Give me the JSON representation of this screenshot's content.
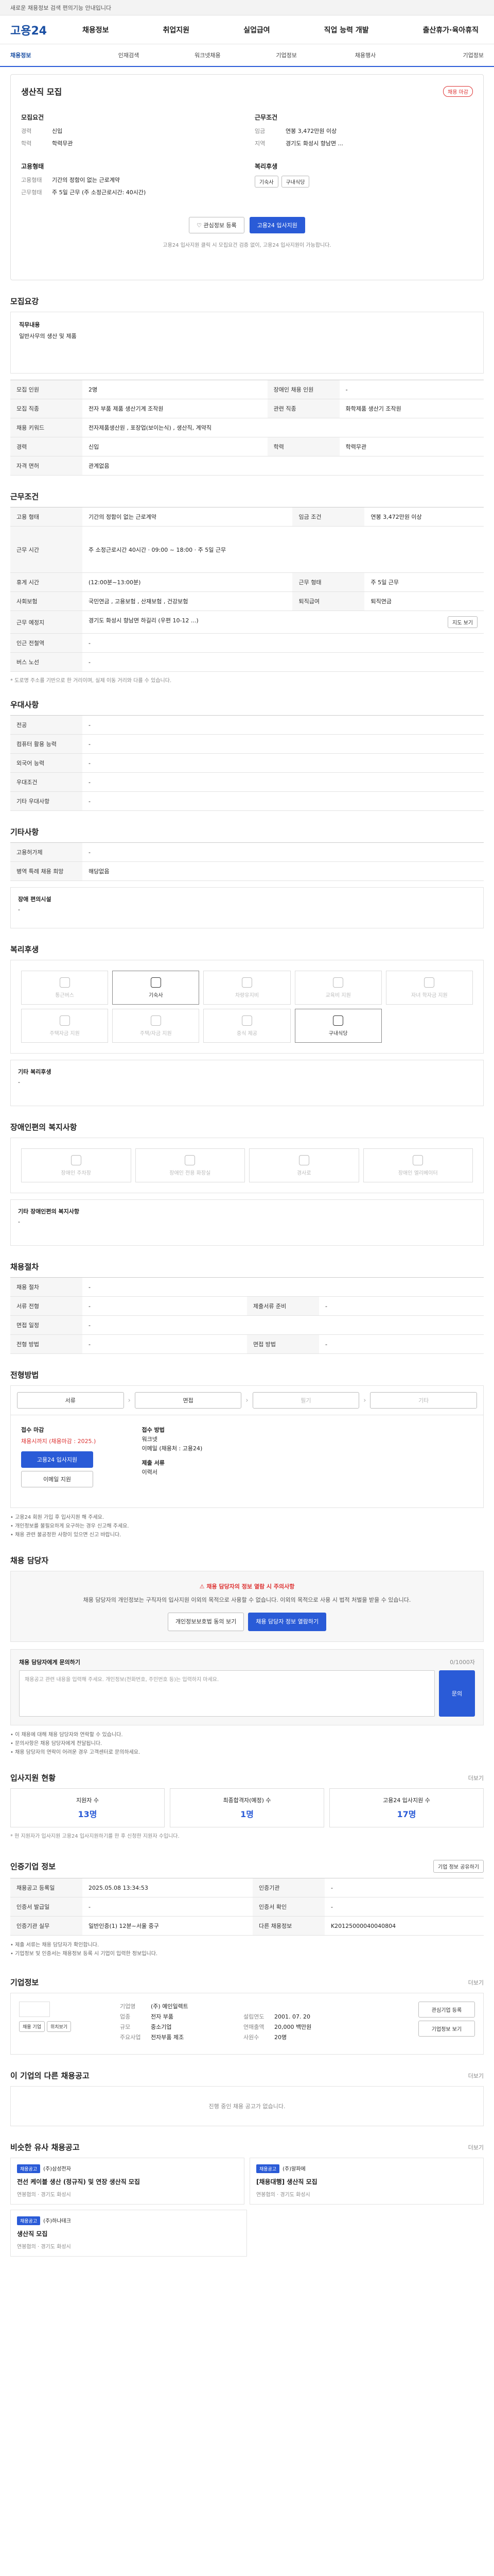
{
  "topbar": {
    "text": "새로운 채용정보 검색 편의기능 안내입니다"
  },
  "header": {
    "logo": "고용24",
    "gnb": [
      "채용정보",
      "취업지원",
      "실업급여",
      "직업 능력 개발",
      "출산휴가·육아휴직"
    ]
  },
  "subnav": [
    "채용정보",
    "인재검색",
    "워크넷채용",
    "기업정보",
    "채용행사",
    "기업정보"
  ],
  "job": {
    "badge": "채용 마감",
    "title": "생산직 모집",
    "left_title": "모집요건",
    "left_rows": [
      {
        "k": "경력",
        "v": "신입"
      },
      {
        "k": "학력",
        "v": "학력무관"
      }
    ],
    "left_title2": "고용형태",
    "left_rows2": [
      {
        "k": "고용형태",
        "v": "기간의 정함이 없는 근로계약"
      },
      {
        "k": "근무형태",
        "v": "주 5일 근무 (주 소정근로시간: 40시간)"
      }
    ],
    "right_title": "근무조건",
    "right_rows": [
      {
        "k": "임금",
        "v": "연봉 3,472만원 이상"
      },
      {
        "k": "지역",
        "v": "경기도 화성시 향남면 ..."
      }
    ],
    "right_title2": "복리후생",
    "right_tags": [
      "기숙사",
      "구내식당"
    ],
    "btn_interest": "관심정보 등록",
    "btn_apply": "고용24 입사지원",
    "apply_note": "고용24 입사지원 클릭 시 모집요건 검증 없이, 고용24 입사지원이 가능합니다."
  },
  "sec_recruit": {
    "title": "모집요강",
    "jobbox_title": "직무내용",
    "jobbox_desc": "일반사무의 생산 및 제품",
    "rows": [
      {
        "k": "모집 인원",
        "v": "2명",
        "k2": "장애인 채용 인원",
        "v2": "-"
      },
      {
        "k": "모집 직종",
        "v": "전자 부품 제품 생산기계 조작원",
        "k2": "관련 직종",
        "v2": "화학제품 생산기 조작원"
      },
      {
        "k": "채용 키워드",
        "v": "전자제품생산원 , 포장업(보이는식) , 생산직, 계약직",
        "k2": "",
        "v2": ""
      },
      {
        "k": "경력",
        "v": "신입",
        "k2": "학력",
        "v2": "학력무관"
      },
      {
        "k": "자격 면허",
        "v": "관계없음",
        "k2": "",
        "v2": ""
      }
    ]
  },
  "sec_cond": {
    "title": "근무조건",
    "rows": [
      {
        "k": "고용 형태",
        "v": "기간의 정함이 없는 근로계약",
        "k2": "임금 조건",
        "v2": "연봉 3,472만원 이상"
      },
      {
        "k": "근무 시간",
        "v": "주 소정근로시간 40시간 · 09:00 ~ 18:00 · 주 5일 근무",
        "k2": "",
        "v2": ""
      },
      {
        "k": "휴게 시간",
        "v": "(12:00분~13:00분)",
        "k2": "근무 형태",
        "v2": "주 5일 근무"
      },
      {
        "k": "사회보험",
        "v": "국민연금 , 고용보험 , 산재보험 , 건강보험",
        "k2": "퇴직급여",
        "v2": "퇴직연금"
      },
      {
        "k": "근무 예정지",
        "v": "경기도 화성시 향남면 하길리 (우편 10-12 ...)",
        "k2": "",
        "v2": ""
      },
      {
        "k": "인근 전철역",
        "v": "-",
        "k2": "",
        "v2": ""
      },
      {
        "k": "버스 노선",
        "v": "-",
        "k2": "",
        "v2": ""
      }
    ],
    "map_btn": "지도 보기",
    "note": "* 도로명 주소를 기반으로 한 거리이며, 실제 이동 거리와 다를 수 있습니다."
  },
  "sec_pref": {
    "title": "우대사항",
    "rows": [
      {
        "k": "전공",
        "v": "-"
      },
      {
        "k": "컴퓨터 활용 능력",
        "v": "-"
      },
      {
        "k": "외국어 능력",
        "v": "-"
      },
      {
        "k": "우대조건",
        "v": "-"
      },
      {
        "k": "기타 우대사항",
        "v": "-"
      }
    ]
  },
  "sec_other": {
    "title": "기타사항",
    "rows": [
      {
        "k": "고용허가제",
        "v": "-"
      },
      {
        "k": "병역 특례 채용 희망",
        "v": "해당없음"
      }
    ],
    "accessible_title": "장애 편의시설",
    "accessible_value": "-"
  },
  "sec_welfare": {
    "title": "복리후생",
    "items": [
      {
        "label": "통근버스",
        "on": false
      },
      {
        "label": "기숙사",
        "on": true
      },
      {
        "label": "차량유지비",
        "on": false
      },
      {
        "label": "교육비 지원",
        "on": false
      },
      {
        "label": "자녀 학자금 지원",
        "on": false
      },
      {
        "label": "주택자금 지원",
        "on": false
      },
      {
        "label": "주택/자금 지원",
        "on": false
      },
      {
        "label": "중식 제공",
        "on": false
      },
      {
        "label": "구내식당",
        "on": true
      }
    ],
    "other_title": "기타 복리후생",
    "other_value": "-"
  },
  "sec_disabled": {
    "title": "장애인편의 복지사항",
    "items": [
      "장애인 주차장",
      "장애인 전용 화장실",
      "경사로",
      "장애인 엘리베이터"
    ],
    "other_title": "기타 장애인편의 복지사항",
    "other_value": "-"
  },
  "sec_procedure": {
    "title": "채용절차",
    "rows": [
      {
        "k": "채용 절차",
        "v": "-"
      },
      {
        "k": "서류 전형",
        "v": "-",
        "k2": "제출서류 준비",
        "v2": "-"
      },
      {
        "k": "면접 일정",
        "v": "-",
        "k2": "",
        "v2": ""
      },
      {
        "k": "전형 방법",
        "v": "-",
        "k2": "면접 방법",
        "v2": "-"
      }
    ]
  },
  "sec_method": {
    "title": "전형방법",
    "steps": [
      "서류",
      "면접",
      "필기",
      "기타"
    ],
    "apply_title": "접수 마감",
    "apply_date": "채용시까지 (채용마감 : 2025.)",
    "apply_btn": "고용24 입사지원",
    "apply_btn2": "이메일 지원",
    "method_title": "접수 방법",
    "method_value": "워크넷",
    "method_value2": "이메일 (채용처 : 고용24)",
    "doc_title": "제출 서류",
    "doc_value": "이력서",
    "notes": [
      "고용24 회원 가입 후 입사지원 해 주세요.",
      "개인정보를 불필요하게 요구하는 경우 신고해 주세요.",
      "채용 관련 불공정한 사항이 있으면 신고 바랍니다."
    ]
  },
  "sec_contact": {
    "title": "채용 담당자",
    "notice_head": "채용 담당자의 정보 열람 시 주의사항",
    "notice_body": "채용 담당자의 개인정보는 구직자의 입사지원 이외의 목적으로 사용할 수 없습니다. 이외의 목적으로 사용 시 법적 처벌을 받을 수 있습니다.",
    "btn_agree": "개인정보보호법 동의 보기",
    "btn_view": "채용 담당자 정보 열람하기",
    "question_title": "채용 담당자에게 문의하기",
    "question_note": "0/1000자 ",
    "question_placeholder": "채용공고 관련 내용을 입력해 주세요. 개인정보(전화번호, 주민번호 등)는 입력하지 마세요.",
    "question_btn": "문의",
    "notes": [
      "이 채용에 대해 채용 담당자와 연락할 수 있습니다.",
      "문의사항은 채용 담당자에게 전달됩니다.",
      "채용 담당자의 연락이 어려운 경우 고객센터로 문의하세요."
    ]
  },
  "sec_stats": {
    "title": "입사지원 현황",
    "more": "더보기",
    "items": [
      {
        "label": "지원자 수",
        "value": "13명"
      },
      {
        "label": "최종합격자(예정) 수",
        "value": "1명"
      },
      {
        "label": "고용24 입사지원 수",
        "value": "17명"
      }
    ],
    "note": "* 현 지원자가 입사지원 고용24 입사지원하기를 한 후 신청한 지원자 수입니다."
  },
  "sec_company": {
    "title": "인증기업 정보",
    "btn": "기업 정보 공유하기",
    "rows": [
      {
        "k": "채용공고 등록일",
        "v": "2025.05.08 13:34:53",
        "k2": "인증기관",
        "v2": "-"
      },
      {
        "k": "인증서 발급일",
        "v": "-",
        "k2": "인증서 확인",
        "v2": "-"
      },
      {
        "k": "인증기관 실무",
        "v": "일반인증(1) 12분~서울 중구",
        "k2": "다른 채용정보",
        "v2": "K20125000040040804"
      }
    ],
    "notes": [
      "제출 서류는 채용 담당자가 확인합니다.",
      "기업정보 및 인증서는 채용정보 등록 시 기업이 입력한 정보입니다."
    ]
  },
  "sec_corp": {
    "title": "기업정보",
    "more": "더보기",
    "name_label": "기업명",
    "name": "(주) 예인일렉트",
    "btn_list": "채용 기업",
    "btn_map": "위치보기",
    "rows": [
      {
        "k": "업종",
        "v": "전자 부품",
        "k2": "설립연도",
        "v2": "2001. 07. 20"
      },
      {
        "k": "규모",
        "v": "중소기업",
        "k2": "연매출액",
        "v2": "20,000 백만원"
      },
      {
        "k": "주요사업",
        "v": "전자부품 제조",
        "k2": "사원수",
        "v2": "20명"
      }
    ],
    "side_btn1": "관심기업 등록",
    "side_btn2": "기업정보 보기"
  },
  "sec_same_corp": {
    "title": "이 기업의 다른 채용공고",
    "more": "더보기",
    "empty": "진행 중인 채용 공고가 없습니다."
  },
  "sec_similar": {
    "title": "비슷한 유사 채용공고",
    "more": "더보기",
    "cards": [
      {
        "chip": "채용공고",
        "org": "(주)삼성전자",
        "title": "전선 케이블 생산 (정규직) 및 연장 생산직 모집",
        "pay": "연봉협의",
        "region": "경기도 화성시"
      },
      {
        "chip": "채용공고",
        "org": "(주)알파에",
        "title": "[채용대행] 생산직 모집",
        "pay": "연봉협의",
        "region": "경기도 화성시"
      },
      {
        "chip": "채용공고",
        "org": "(주)하나테크",
        "title": "생산직 모집",
        "pay": "연봉협의",
        "region": "경기도 화성시"
      }
    ]
  }
}
